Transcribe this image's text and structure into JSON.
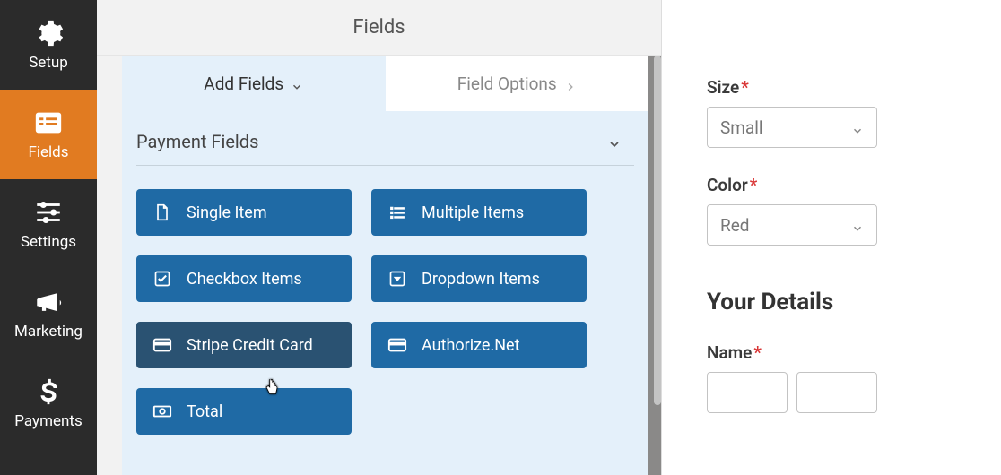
{
  "sidebar": {
    "items": [
      {
        "label": "Setup"
      },
      {
        "label": "Fields"
      },
      {
        "label": "Settings"
      },
      {
        "label": "Marketing"
      },
      {
        "label": "Payments"
      }
    ]
  },
  "center": {
    "title": "Fields",
    "tabs": {
      "add_fields": "Add Fields",
      "field_options": "Field Options"
    },
    "section_title": "Payment Fields",
    "fields": {
      "single_item": "Single Item",
      "multiple_items": "Multiple Items",
      "checkbox_items": "Checkbox Items",
      "dropdown_items": "Dropdown Items",
      "stripe_credit_card": "Stripe Credit Card",
      "authorize_net": "Authorize.Net",
      "total": "Total"
    }
  },
  "right": {
    "size_label": "Size",
    "size_value": "Small",
    "color_label": "Color",
    "color_value": "Red",
    "details_title": "Your Details",
    "name_label": "Name"
  }
}
